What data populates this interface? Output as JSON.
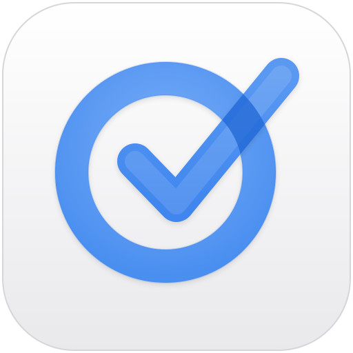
{
  "app_icon": {
    "icon": "checkmark-in-ring-icon",
    "colors": {
      "tile_top": "#ffffff",
      "tile_bottom": "#e9e9ec",
      "tile_border": "#d6d6da",
      "ring": "#4a8ff0",
      "ring_highlight": "#79adf7",
      "check": "#3f86ee",
      "overlap": "#1f66d4"
    }
  }
}
